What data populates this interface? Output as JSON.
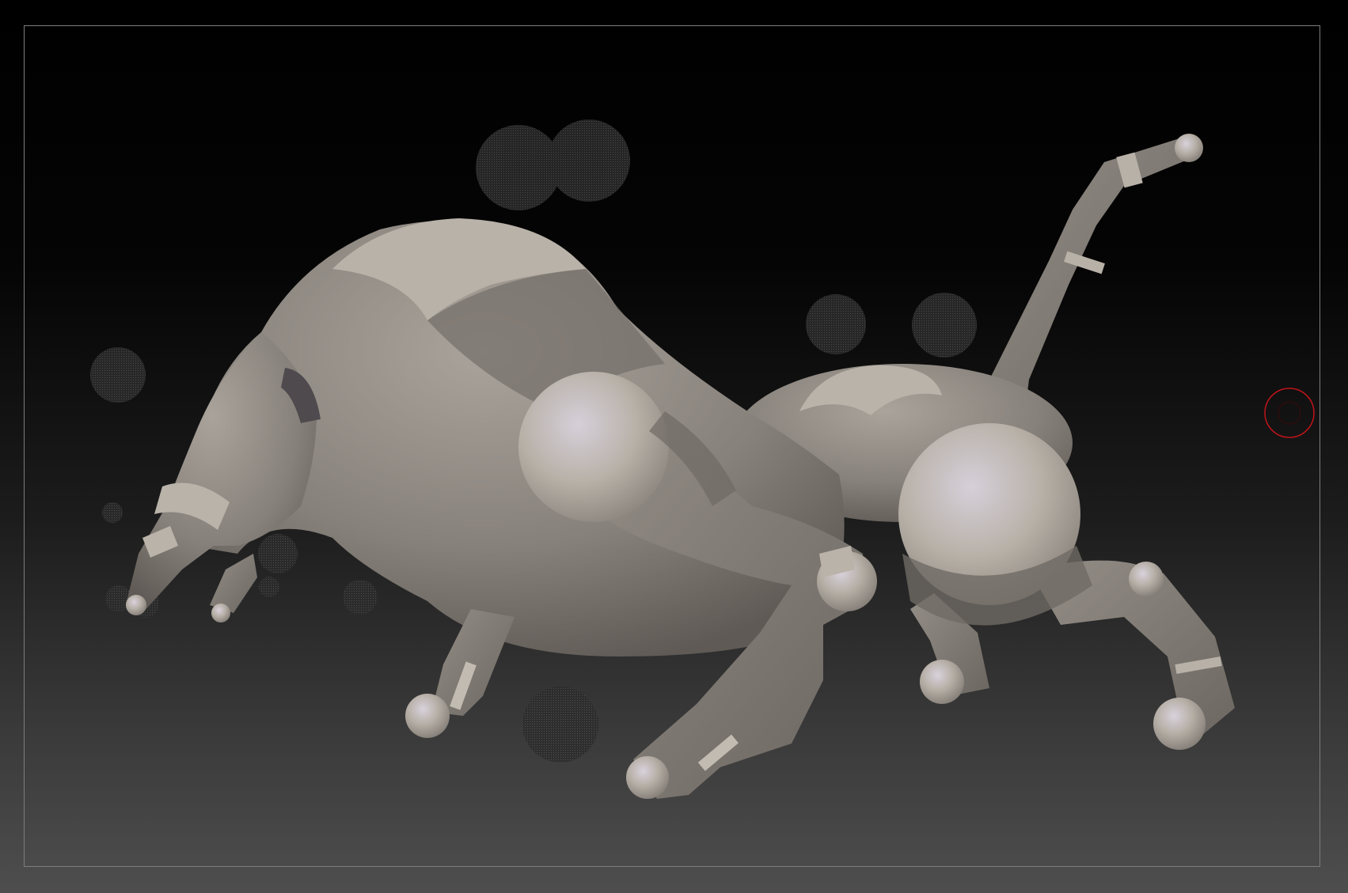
{
  "viewport": {
    "background_top": "#000000",
    "background_bottom": "#4e4e4e",
    "frame_color": "#7d7d7d"
  },
  "model": {
    "base_color": "#8a847e",
    "light_color": "#b9b2a9",
    "highlight_color": "#cfc7d6",
    "dark_color": "#6d6862"
  },
  "cursor": {
    "icon": "brush-cursor-icon",
    "color": "#c0141a"
  },
  "ghost_spheres": {
    "color": "#3a3a3a"
  }
}
